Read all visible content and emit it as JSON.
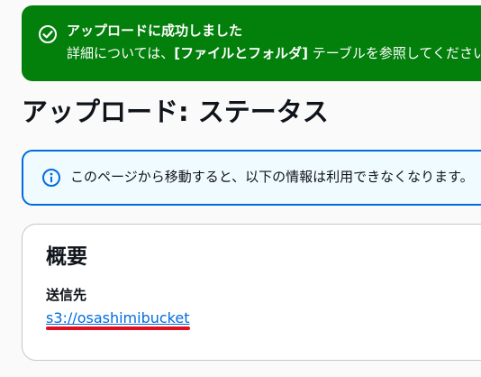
{
  "flash": {
    "title": "アップロードに成功しました",
    "body_prefix": "詳細については、",
    "body_emphasis": "[ファイルとフォルダ]",
    "body_suffix": " テーブルを参照してください。",
    "icon": "check-circle-icon",
    "color": "#037f0c"
  },
  "page": {
    "title": "アップロード: ステータス"
  },
  "info_alert": {
    "text": "このページから移動すると、以下の情報は利用できなくなります。",
    "icon": "info-circle-icon",
    "border_color": "#006ce0"
  },
  "overview": {
    "title": "概要",
    "destination_label": "送信先",
    "destination_value": "s3://osashimibucket",
    "link_color": "#006ce0",
    "annotation_color": "#e0101e"
  }
}
